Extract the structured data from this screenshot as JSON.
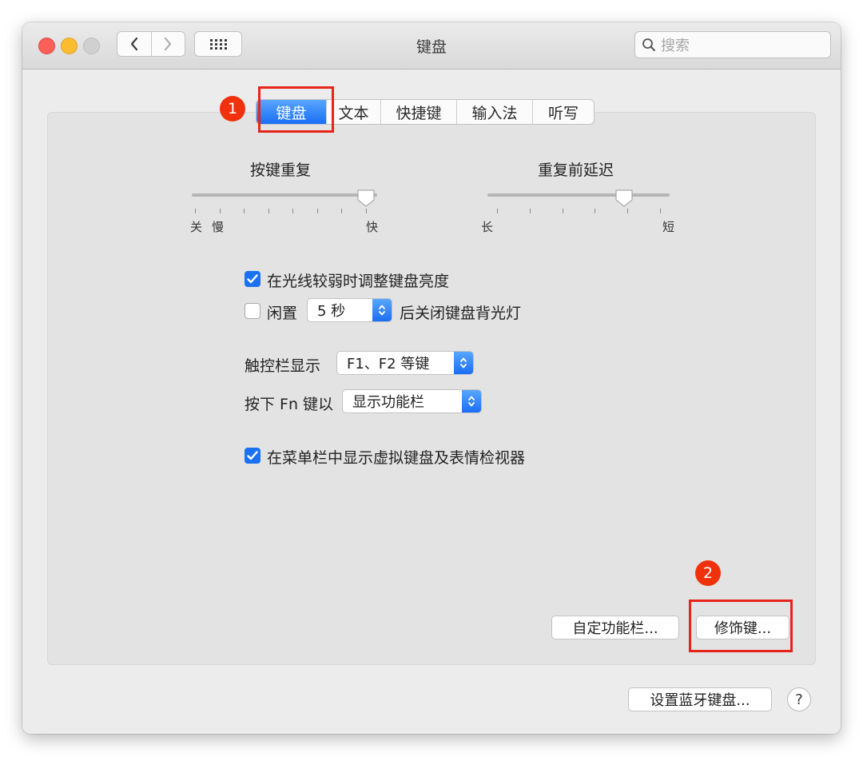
{
  "window": {
    "title": "键盘"
  },
  "search": {
    "placeholder": "搜索",
    "icon": "search-icon"
  },
  "tabs": [
    {
      "label": "键盘",
      "selected": true
    },
    {
      "label": "文本",
      "selected": false
    },
    {
      "label": "快捷键",
      "selected": false
    },
    {
      "label": "输入法",
      "selected": false
    },
    {
      "label": "听写",
      "selected": false
    }
  ],
  "annotations": [
    {
      "label": "1"
    },
    {
      "label": "2"
    }
  ],
  "key_repeat": {
    "label": "按键重复",
    "left_labels": [
      "关",
      "慢"
    ],
    "right_label": "快",
    "value": 1.0
  },
  "delay_until_repeat": {
    "label": "重复前延迟",
    "left_label": "长",
    "right_label": "短",
    "value": 0.78
  },
  "options": {
    "brightness": {
      "label": "在光线较弱时调整键盘亮度",
      "checked": true
    },
    "backlight": {
      "prefix": "闲置",
      "value": "5 秒",
      "suffix": "后关闭键盘背光灯",
      "checked": false
    },
    "touchbar": {
      "label": "触控栏显示",
      "value": "F1、F2 等键"
    },
    "fn_key": {
      "label": "按下 Fn 键以",
      "value": "显示功能栏"
    },
    "menubar_viewer": {
      "label": "在菜单栏中显示虚拟键盘及表情检视器",
      "checked": true
    }
  },
  "buttons": {
    "customize_touchbar": "自定功能栏...",
    "modifier_keys": "修饰键...",
    "bluetooth_keyboard": "设置蓝牙键盘...",
    "help": "?"
  },
  "colors": {
    "accent": "#1a72f3",
    "annotation_red": "#e8231a"
  }
}
